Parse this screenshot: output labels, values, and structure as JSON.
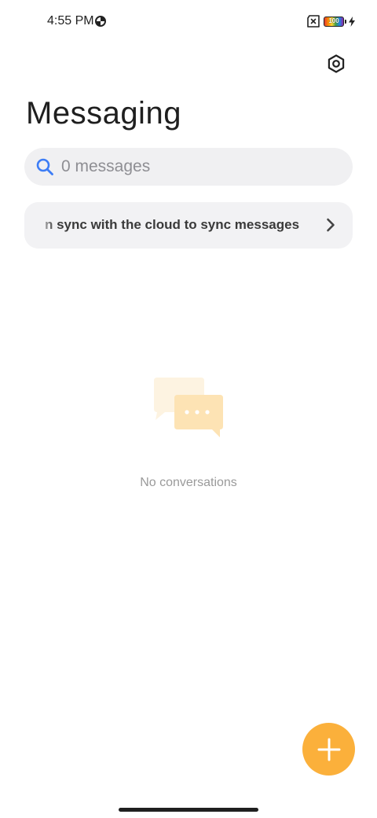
{
  "status_bar": {
    "time": "4:55 PM",
    "battery_level": "100",
    "icons": [
      "data-saver-icon",
      "no-sim-icon",
      "battery-icon",
      "charging-bolt-icon"
    ]
  },
  "header": {
    "title": "Messaging",
    "settings_icon": "settings-icon"
  },
  "search": {
    "placeholder": "0 messages",
    "icon": "search-icon"
  },
  "sync_banner": {
    "text": "n sync with the cloud to sync messages",
    "icon": "chevron-right-icon"
  },
  "empty_state": {
    "icon": "chat-bubbles-icon",
    "text": "No conversations"
  },
  "fab": {
    "icon": "plus-icon"
  },
  "colors": {
    "accent": "#fbb03b",
    "search_icon": "#3d7df6",
    "surface": "#f0f0f2"
  }
}
